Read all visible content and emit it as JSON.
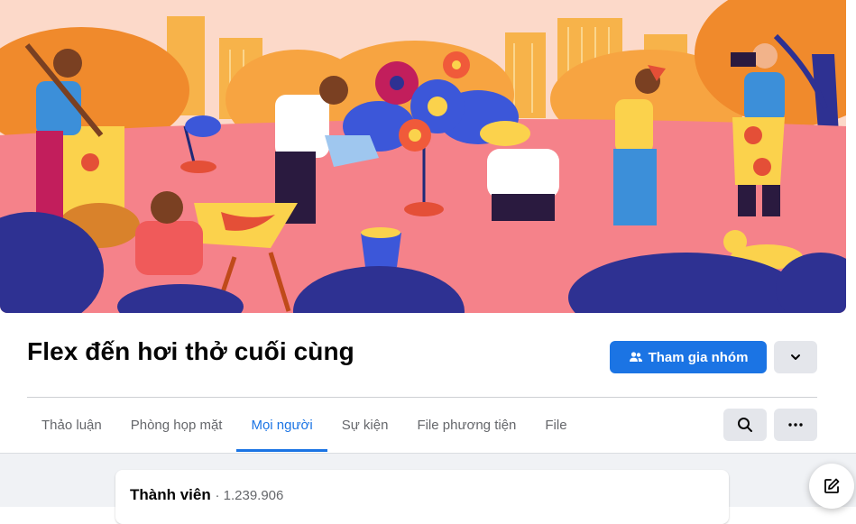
{
  "group": {
    "name": "Flex đến hơi thở cuối cùng",
    "join_label": "Tham gia nhóm"
  },
  "tabs": [
    {
      "label": "Thảo luận",
      "active": false
    },
    {
      "label": "Phòng họp mặt",
      "active": false
    },
    {
      "label": "Mọi người",
      "active": true
    },
    {
      "label": "Sự kiện",
      "active": false
    },
    {
      "label": "File phương tiện",
      "active": false
    },
    {
      "label": "File",
      "active": false
    }
  ],
  "members": {
    "title": "Thành viên",
    "count": "· 1.239.906"
  },
  "colors": {
    "accent": "#1b74e4",
    "button_gray": "#e4e6eb",
    "cover_bg": "#fbd3c8"
  },
  "icons": {
    "join": "people-icon",
    "dropdown": "chevron-down-icon",
    "search": "search-icon",
    "more": "more-horizontal-icon",
    "compose": "compose-icon"
  }
}
